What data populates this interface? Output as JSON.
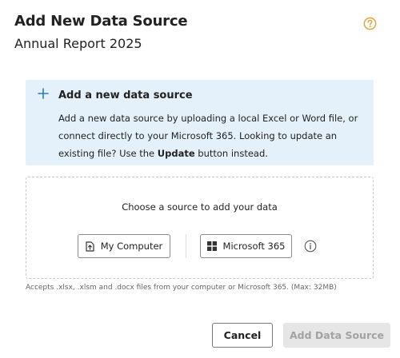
{
  "dialog": {
    "title": "Add New Data Source",
    "subtitle": "Annual Report 2025",
    "help_icon": "question-circle-icon"
  },
  "info": {
    "icon": "plus-icon",
    "heading": "Add a new data source",
    "body_prefix": "Add a new data source by uploading a local Excel or Word file, or connect directly to your Microsoft 365. Looking to update an existing file? Use the ",
    "body_bold": "Update",
    "body_suffix": " button instead."
  },
  "dropzone": {
    "prompt": "Choose a source to add your data",
    "buttons": [
      {
        "label": "My Computer",
        "icon": "upload-file-icon"
      },
      {
        "label": "Microsoft 365",
        "icon": "windows-logo-icon"
      }
    ],
    "info_icon": "info-circle-icon"
  },
  "footnote": "Accepts .xlsx, .xlsm and .docx files from your computer or Microsoft 365. (Max: 32MB)",
  "footer": {
    "cancel_label": "Cancel",
    "add_label": "Add Data Source"
  },
  "colors": {
    "accent_orange": "#e8a33c",
    "info_bg": "#e4f1fb",
    "plus_blue": "#2b7bb9",
    "disabled_bg": "#e6e6e6",
    "disabled_text": "#a2a2a2"
  }
}
